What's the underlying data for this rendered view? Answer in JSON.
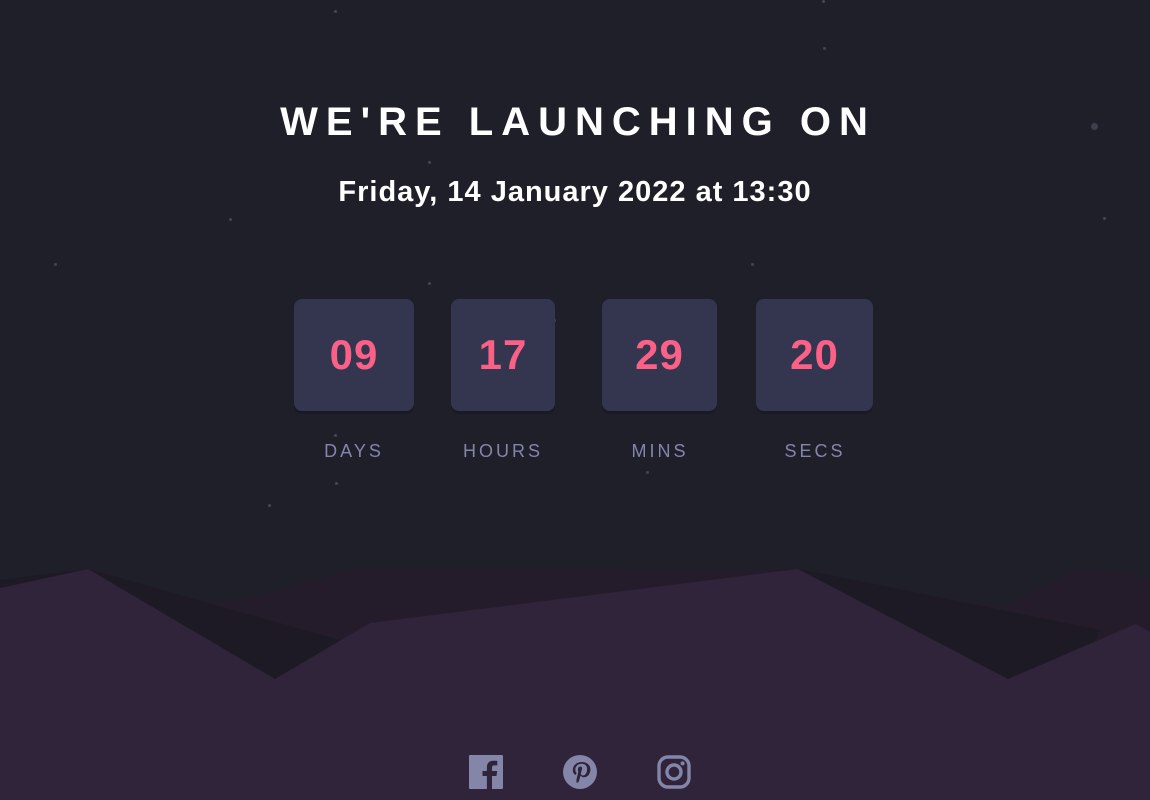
{
  "heading": "WE'RE LAUNCHING ON",
  "launch_date": "Friday, 14 January 2022 at 13:30",
  "countdown": [
    {
      "value": "09",
      "unit": "DAYS"
    },
    {
      "value": "17",
      "unit": "HOURS"
    },
    {
      "value": "29",
      "unit": "MINS"
    },
    {
      "value": "20",
      "unit": "SECS"
    }
  ],
  "social_links": [
    {
      "icon": "facebook-icon"
    },
    {
      "icon": "pinterest-icon"
    },
    {
      "icon": "instagram-icon"
    }
  ],
  "colors": {
    "background": "#1e1f29",
    "card": "#343650",
    "number": "#fb6087",
    "label": "#8385a9",
    "hills": "#2f2439",
    "icons": "#8385a9"
  }
}
